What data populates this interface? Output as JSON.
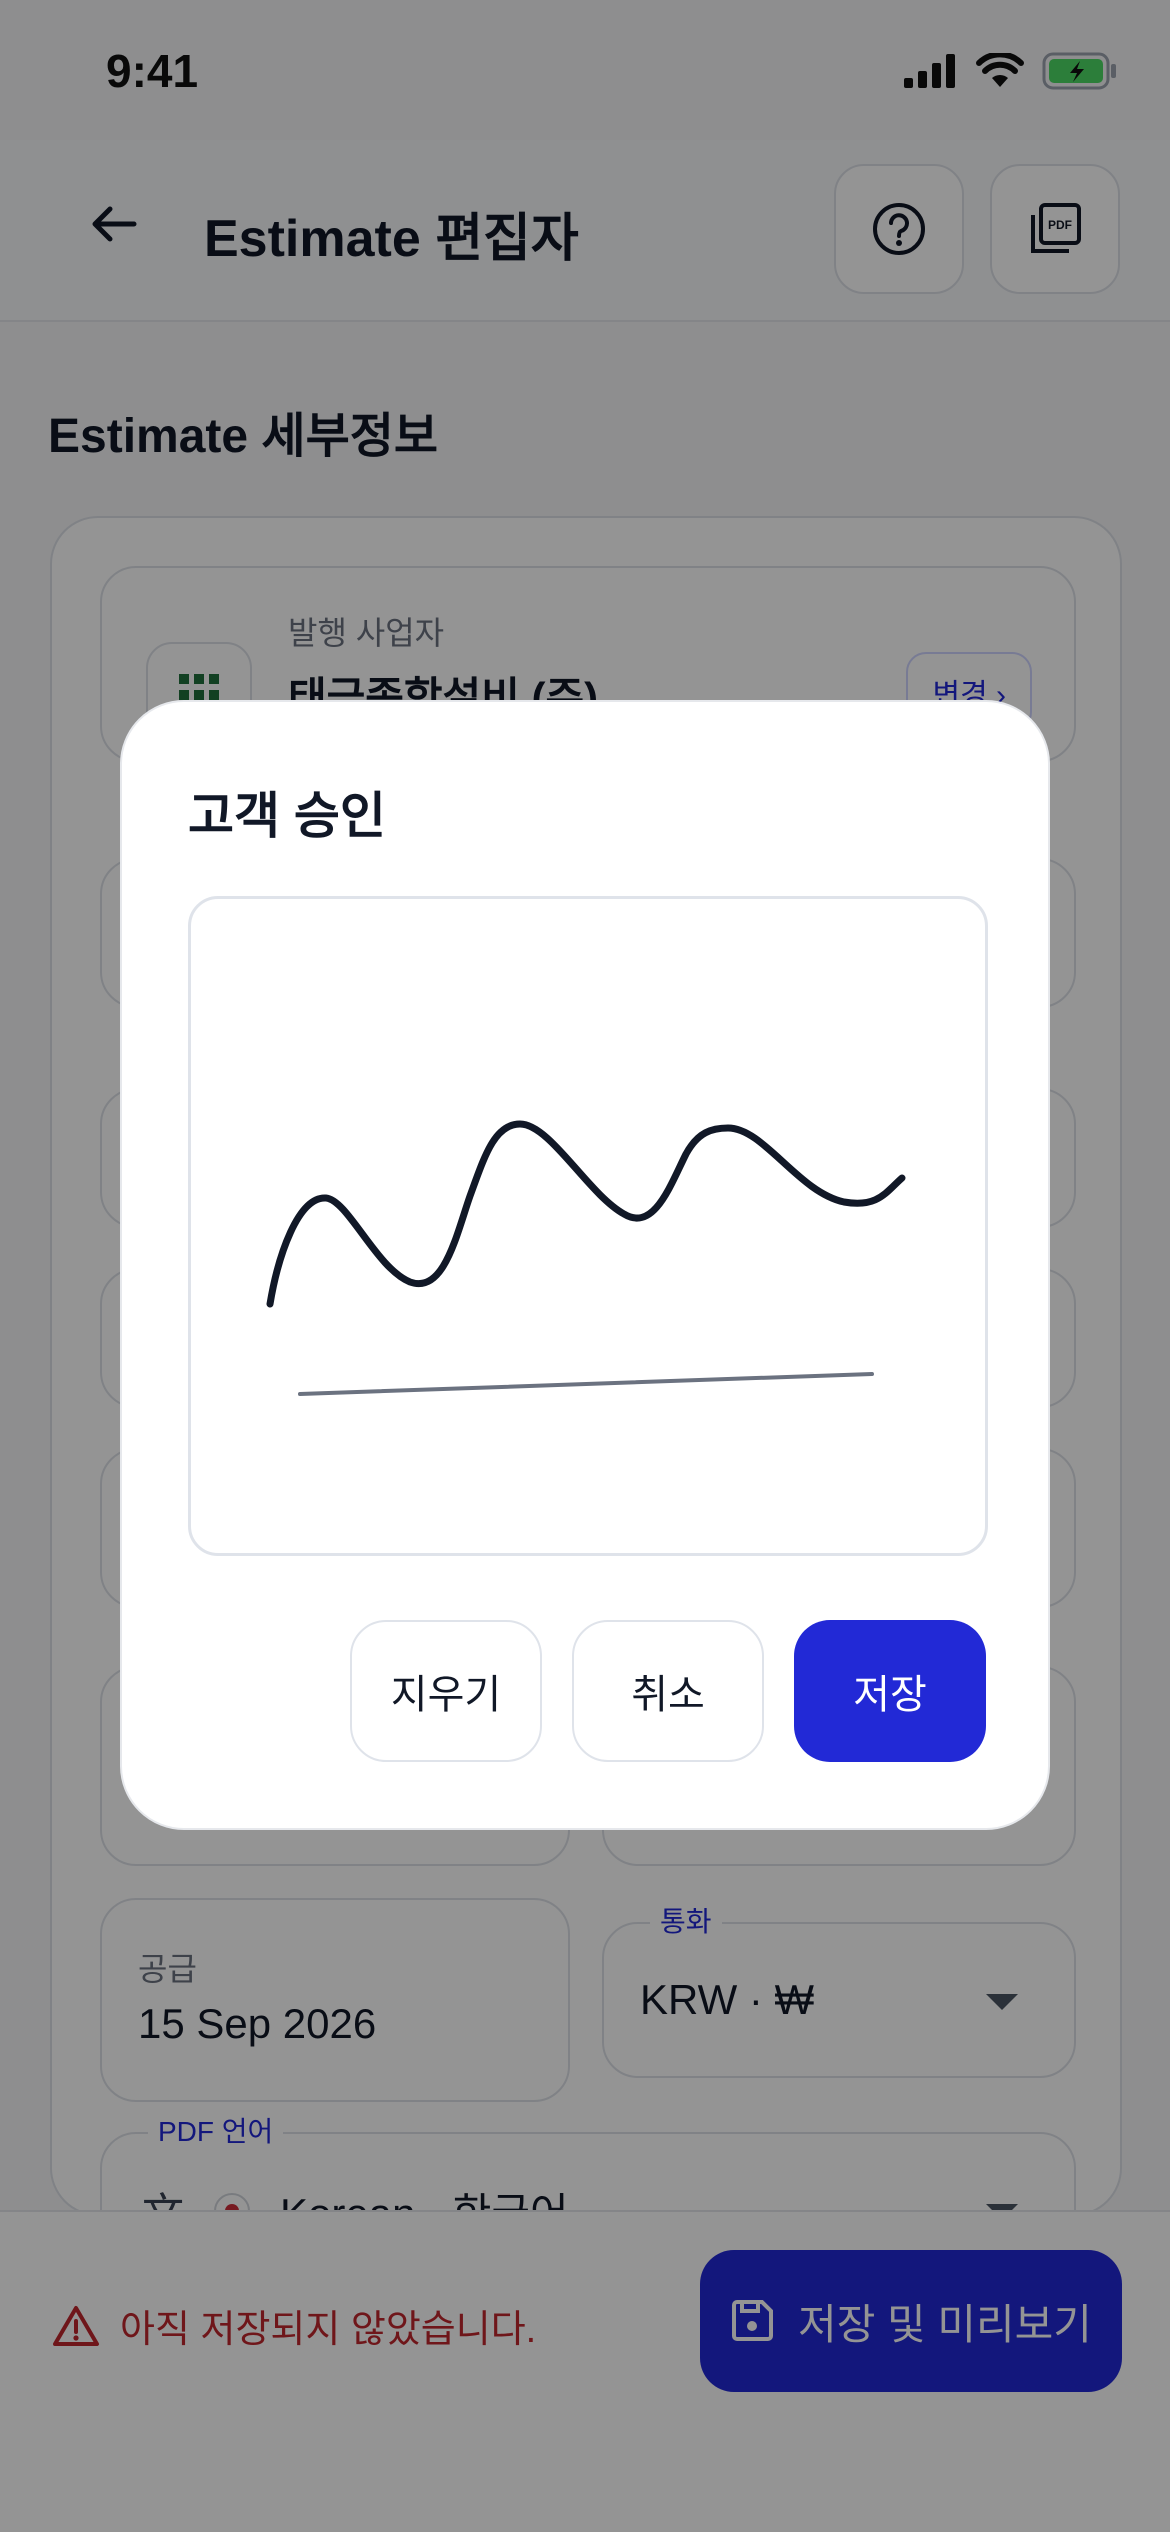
{
  "status_bar": {
    "time": "9:41"
  },
  "header": {
    "title": "Estimate 편집자",
    "help_icon": "help-circle-icon",
    "pdf_icon": "pdf-icon"
  },
  "section": {
    "title": "Estimate 세부정보"
  },
  "issuer": {
    "label": "발행 사업자",
    "value": "태금종합설비 (주)",
    "change_label": "변경 ›"
  },
  "supply": {
    "label": "공급",
    "value": "15 Sep 2026"
  },
  "currency": {
    "label": "통화",
    "value": "KRW · ₩"
  },
  "pdf_language": {
    "label": "PDF 언어",
    "value": "Korean · 한국어"
  },
  "footer": {
    "warning": "아직 저장되지 않았습니다.",
    "save_preview_label": "저장 및 미리보기"
  },
  "dialog": {
    "title": "고객 승인",
    "buttons": {
      "clear": "지우기",
      "cancel": "취소",
      "save": "저장"
    }
  },
  "colors": {
    "primary": "#2229D6",
    "warning": "#C0262D",
    "signature_ink": "#111827"
  }
}
